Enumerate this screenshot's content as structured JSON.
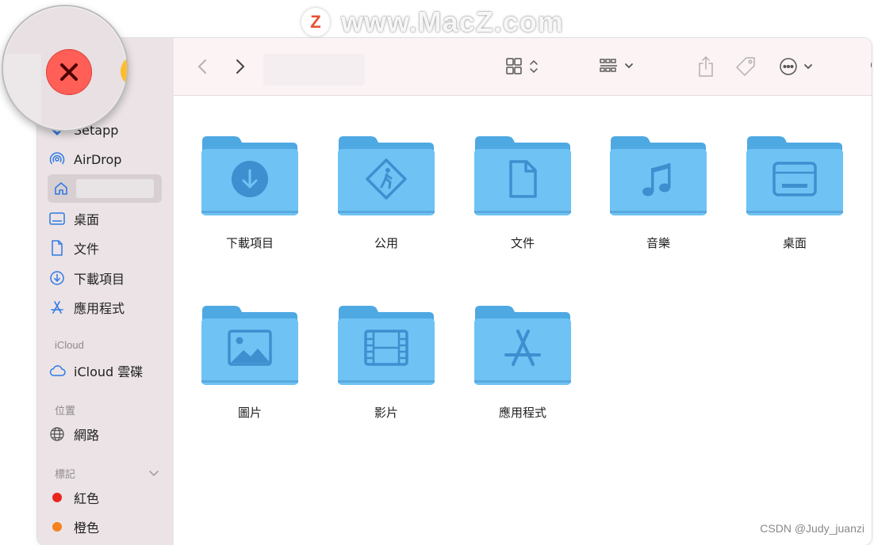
{
  "watermark": {
    "logo_letter": "Z",
    "text": "www.MacZ.com"
  },
  "sidebar": {
    "items": [
      {
        "label": "Setapp",
        "icon": "setapp-icon"
      },
      {
        "label": "AirDrop",
        "icon": "airdrop-icon"
      },
      {
        "label": "",
        "icon": "home-icon",
        "selected": true
      },
      {
        "label": "桌面",
        "icon": "desktop-icon"
      },
      {
        "label": "文件",
        "icon": "document-icon"
      },
      {
        "label": "下載項目",
        "icon": "download-icon"
      },
      {
        "label": "應用程式",
        "icon": "applications-icon"
      }
    ],
    "icloud_header": "iCloud",
    "icloud_item": "iCloud 雲碟",
    "locations_header": "位置",
    "network_item": "網路",
    "tags_header": "標記",
    "tags": [
      {
        "label": "紅色",
        "color": "#e8261f"
      },
      {
        "label": "橙色",
        "color": "#f5831f"
      }
    ]
  },
  "toolbar": {
    "back_icon": "chevron-left-icon",
    "forward_icon": "chevron-right-icon",
    "view_icon": "grid-view-icon",
    "group_icon": "group-by-icon",
    "share_icon": "share-icon",
    "tag_icon": "tag-icon",
    "more_icon": "ellipsis-circle-icon",
    "search_icon": "search-icon"
  },
  "folders": [
    {
      "label": "下載項目",
      "glyph": "download"
    },
    {
      "label": "公用",
      "glyph": "public"
    },
    {
      "label": "文件",
      "glyph": "document"
    },
    {
      "label": "音樂",
      "glyph": "music"
    },
    {
      "label": "桌面",
      "glyph": "desktop"
    },
    {
      "label": "圖片",
      "glyph": "pictures"
    },
    {
      "label": "影片",
      "glyph": "movies"
    },
    {
      "label": "應用程式",
      "glyph": "applications"
    }
  ],
  "colors": {
    "folder_body": "#6ec3f4",
    "folder_tab": "#4ea8e2",
    "folder_glyph": "#3d8fcf",
    "close_button": "#ff5f57",
    "sidebar_icon": "#2f7ae5"
  },
  "credit": "CSDN @Judy_juanzi"
}
